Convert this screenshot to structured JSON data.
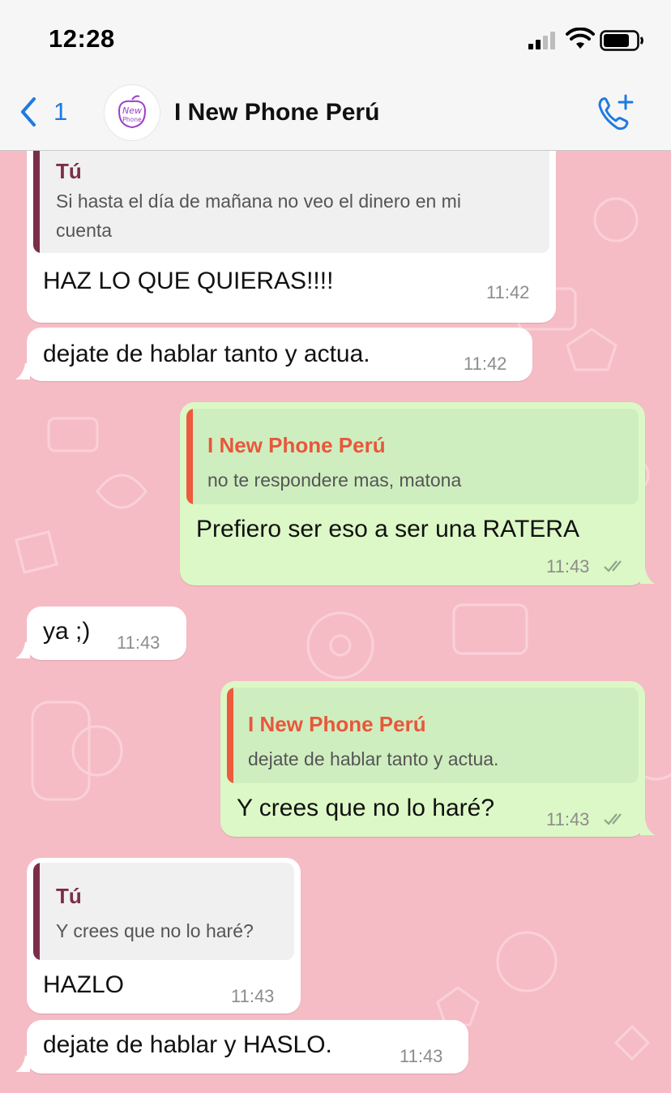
{
  "status_bar": {
    "time": "12:28"
  },
  "header": {
    "back_count": "1",
    "contact_name": "I New Phone Perú",
    "avatar_text_top": "New",
    "avatar_text_bottom": "Phone"
  },
  "colors": {
    "chat_background": "#f6bcc5",
    "incoming_bubble": "#ffffff",
    "outgoing_bubble": "#dcf8c6",
    "accent_blue": "#1f7ae0",
    "quote_me": "#7b2d4a",
    "quote_them": "#ee5a3c"
  },
  "messages": [
    {
      "direction": "in",
      "quote_author": "Tú",
      "quote_line1": "Si hasta el día de mañana no veo el dinero en mi",
      "quote_line2": "cuenta",
      "text": "HAZ LO QUE QUIERAS!!!!",
      "time": "11:42"
    },
    {
      "direction": "in",
      "text": "dejate de hablar tanto y actua.",
      "time": "11:42"
    },
    {
      "direction": "out",
      "quote_author": "I New Phone Perú",
      "quote_line1": "no te respondere mas, matona",
      "text": "Prefiero ser eso a ser una RATERA",
      "time": "11:43",
      "status": "read"
    },
    {
      "direction": "in",
      "text": "ya ;)",
      "time": "11:43"
    },
    {
      "direction": "out",
      "quote_author": "I New Phone Perú",
      "quote_line1": "dejate de hablar tanto y actua.",
      "text": "Y crees que no lo haré?",
      "time": "11:43",
      "status": "read"
    },
    {
      "direction": "in",
      "quote_author": "Tú",
      "quote_line1": "Y crees que no lo haré?",
      "text": "HAZLO",
      "time": "11:43"
    },
    {
      "direction": "in",
      "text": "dejate de hablar y HASLO.",
      "time": "11:43"
    }
  ]
}
